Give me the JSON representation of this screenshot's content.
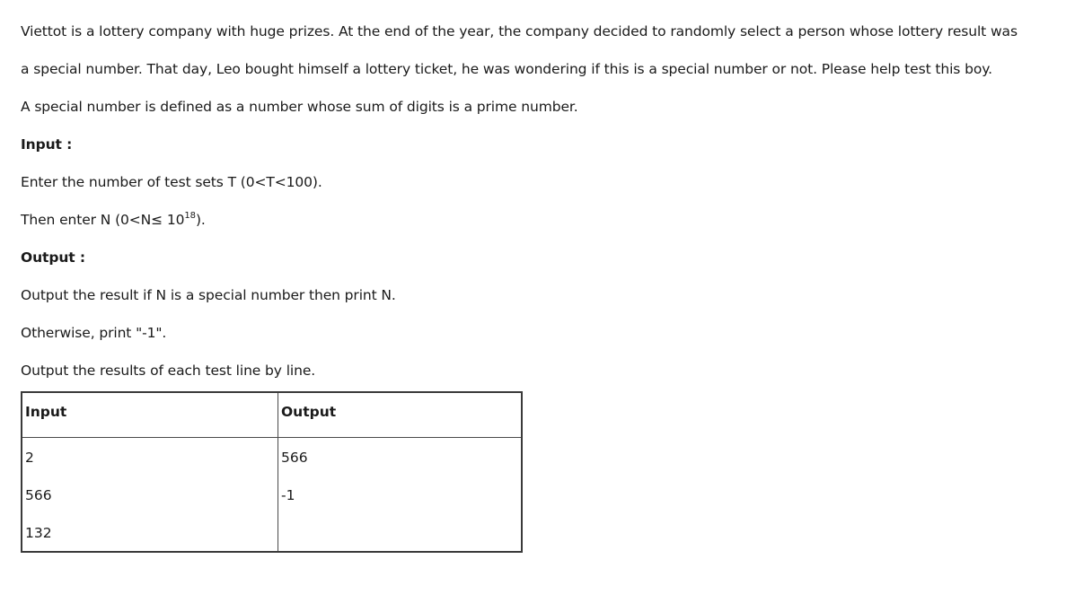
{
  "problem": {
    "intro_line1": "Viettot is a lottery company with huge prizes. At the end of the year, the company decided to randomly select a person whose lottery result was",
    "intro_line2": "a special number. That day, Leo bought himself a lottery ticket, he was wondering if this is a special number or not. Please help test this boy.",
    "definition": "A special number is defined as a number whose sum of digits is a prime number.",
    "input_heading": "Input :",
    "input_line1": "Enter the number of test sets T (0<T<100).",
    "input_line2_prefix": "Then enter N (0<N≤ 10",
    "input_line2_exponent": "18",
    "input_line2_suffix": ").",
    "output_heading": "Output :",
    "output_line1": "Output the result if N is a special number then print N.",
    "output_line2": "Otherwise, print \"-1\".",
    "output_line3": "Output the results of each test line by line."
  },
  "example_table": {
    "headers": [
      "Input",
      "Output"
    ],
    "input_lines": [
      "2",
      "566",
      "132"
    ],
    "output_lines": [
      "566",
      "-1"
    ]
  }
}
